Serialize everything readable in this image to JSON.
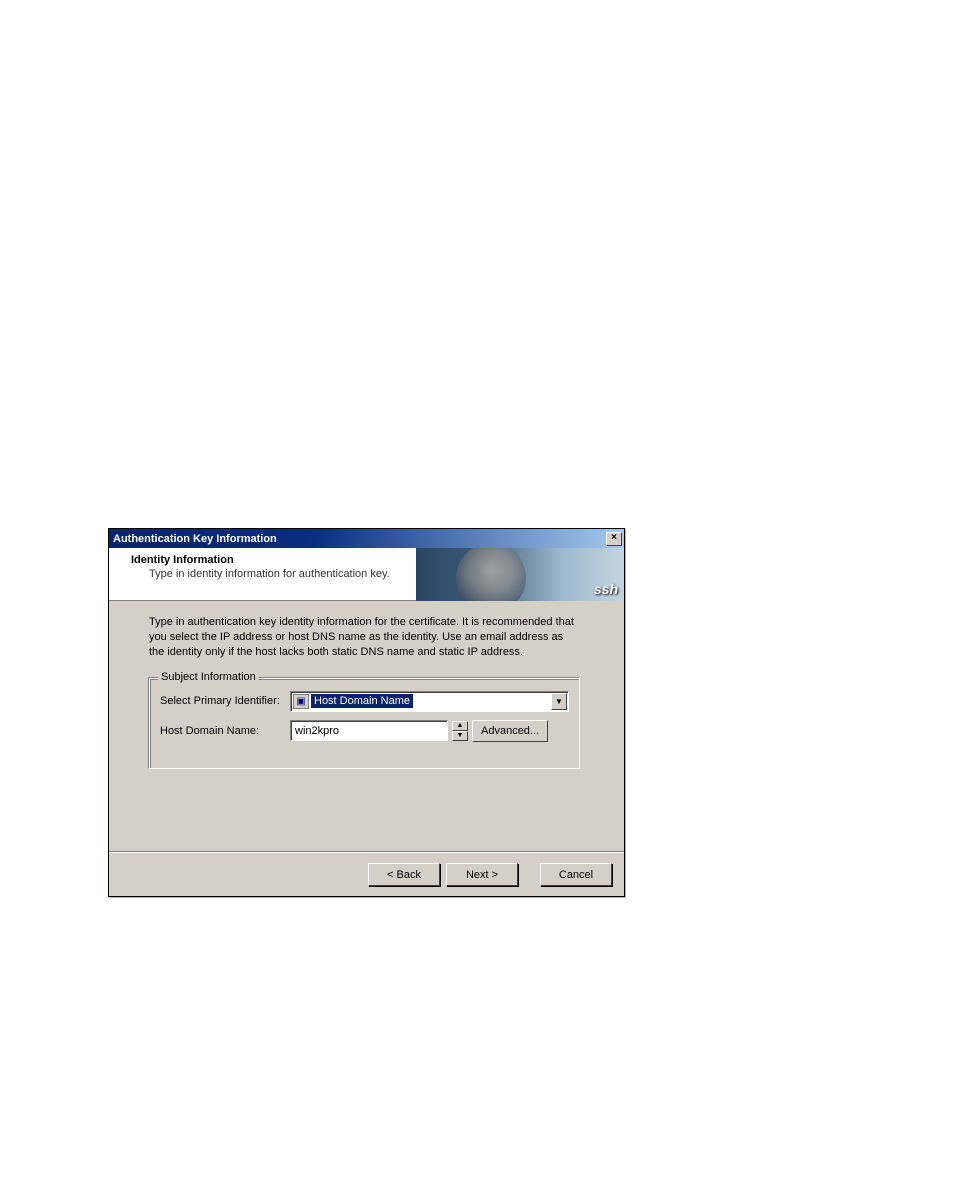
{
  "dialog": {
    "title": "Authentication Key Information",
    "close_glyph": "×"
  },
  "header": {
    "title": "Identity Information",
    "subtitle": "Type in identity information for authentication key.",
    "logo": "ssh"
  },
  "description": "Type in authentication key identity information for the certificate. It is recommended that you select the IP address or host DNS name as the identity. Use an email address as the identity only if the host lacks both static DNS name and static IP address.",
  "group": {
    "legend": "Subject Information",
    "primary_label": "Select Primary Identifier:",
    "primary_value": "Host Domain Name",
    "hostname_label": "Host Domain Name:",
    "hostname_value": "win2kpro",
    "advanced_label": "Advanced..."
  },
  "footer": {
    "back": "< Back",
    "next": "Next >",
    "cancel": "Cancel"
  }
}
